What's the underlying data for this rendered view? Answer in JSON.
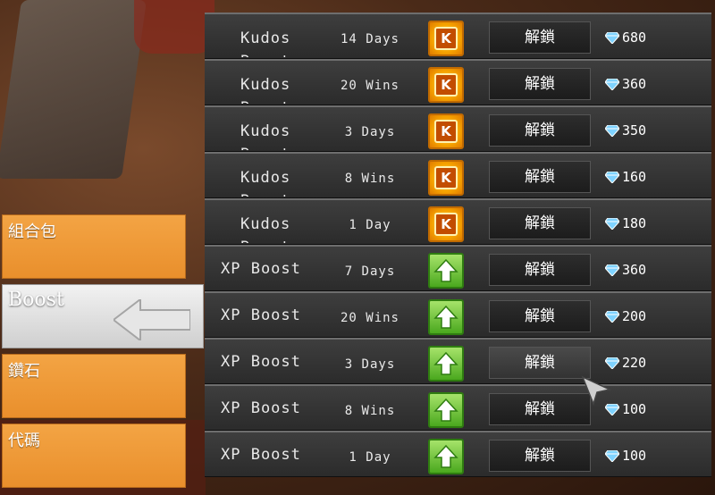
{
  "categories": [
    {
      "label": "組合包",
      "active": false
    },
    {
      "label": "Boost",
      "active": true
    },
    {
      "label": "鑽石",
      "active": false
    },
    {
      "label": "代碼",
      "active": false
    }
  ],
  "items": [
    {
      "name": "Kudos Boost",
      "duration": "14 Days",
      "icon": "kudos-icon",
      "icon_letter": "K",
      "button": "解鎖",
      "price": "680"
    },
    {
      "name": "Kudos Boost",
      "duration": "20 Wins",
      "icon": "kudos-icon",
      "icon_letter": "K",
      "button": "解鎖",
      "price": "360"
    },
    {
      "name": "Kudos Boost",
      "duration": "3 Days",
      "icon": "kudos-icon",
      "icon_letter": "K",
      "button": "解鎖",
      "price": "350"
    },
    {
      "name": "Kudos Boost",
      "duration": "8 Wins",
      "icon": "kudos-icon",
      "icon_letter": "K",
      "button": "解鎖",
      "price": "160"
    },
    {
      "name": "Kudos Boost",
      "duration": "1 Day",
      "icon": "kudos-icon",
      "icon_letter": "K",
      "button": "解鎖",
      "price": "180"
    },
    {
      "name": "XP Boost",
      "duration": "7 Days",
      "icon": "xp-arrow-icon",
      "button": "解鎖",
      "price": "360"
    },
    {
      "name": "XP Boost",
      "duration": "20 Wins",
      "icon": "xp-arrow-icon",
      "button": "解鎖",
      "price": "200"
    },
    {
      "name": "XP Boost",
      "duration": "3 Days",
      "icon": "xp-arrow-icon",
      "button": "解鎖",
      "price": "220"
    },
    {
      "name": "XP Boost",
      "duration": "8 Wins",
      "icon": "xp-arrow-icon",
      "button": "解鎖",
      "price": "100"
    },
    {
      "name": "XP Boost",
      "duration": "1 Day",
      "icon": "xp-arrow-icon",
      "button": "解鎖",
      "price": "100"
    }
  ],
  "currency_icon": "diamond-icon",
  "colors": {
    "category_orange": "#e98f2c",
    "active_gray": "#d9d9d9",
    "gem_blue": "#7fd3ff",
    "xp_green": "#4aa81e",
    "kudos_orange": "#f6a300"
  }
}
